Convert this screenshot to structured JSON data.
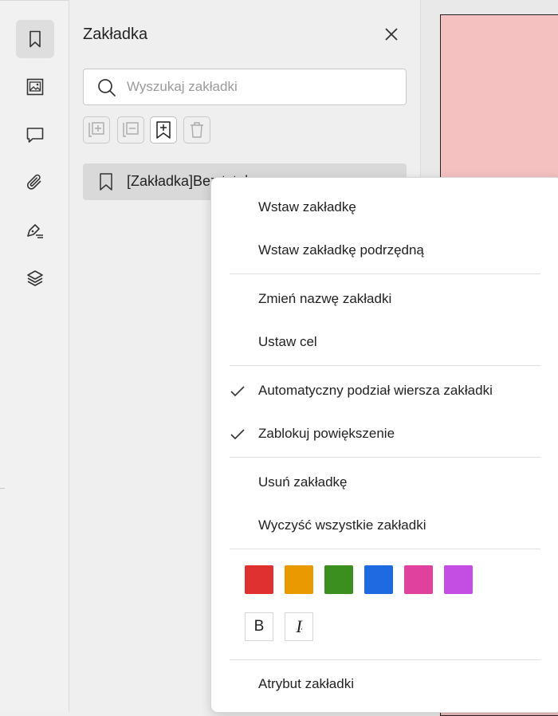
{
  "panel": {
    "title": "Zakładka",
    "search_placeholder": "Wyszukaj zakładki"
  },
  "bookmark": {
    "label": "[Zakładka]Bez tytułu"
  },
  "rail": {
    "items": [
      "bookmark-icon",
      "image-icon",
      "comment-icon",
      "attachment-icon",
      "signature-icon",
      "layers-icon"
    ],
    "active": "bookmark-icon"
  },
  "toolbar": {
    "buttons": [
      "expand-all-icon",
      "collapse-all-icon",
      "add-bookmark-icon",
      "delete-icon"
    ]
  },
  "menu": {
    "insert": "Wstaw zakładkę",
    "insert_child": "Wstaw zakładkę podrzędną",
    "rename": "Zmień nazwę zakładki",
    "set_target": "Ustaw cel",
    "auto_wrap": "Automatyczny podział wiersza zakładki",
    "auto_wrap_checked": true,
    "lock_zoom": "Zablokuj powiększenie",
    "lock_zoom_checked": true,
    "delete": "Usuń zakładkę",
    "clear_all": "Wyczyść wszystkie zakładki",
    "bold_label": "B",
    "italic_label": "I",
    "attributes": "Atrybut zakładki"
  },
  "colors": {
    "swatches": [
      "#e03131",
      "#e89a00",
      "#3a8f1f",
      "#1f6ae0",
      "#e0409e",
      "#c44de3"
    ],
    "doc_page": "#f4c0c0"
  }
}
